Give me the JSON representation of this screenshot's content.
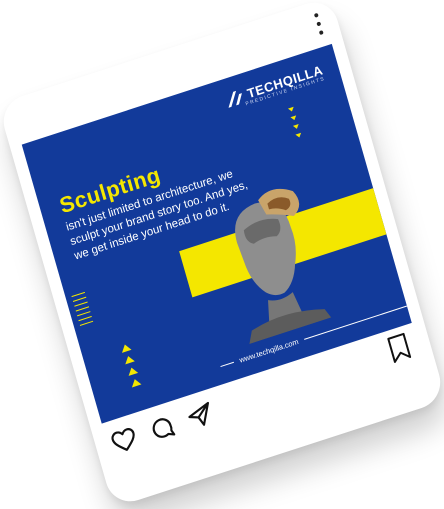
{
  "post": {
    "brand": "TECHQILLA",
    "brand_tagline": "PREDICTIVE INSIGHTS",
    "headline": "Sculpting",
    "body": "isn't just limited to architecture, we sculpt your brand story too. And yes, we get inside your head to do it.",
    "url": "www.techqilla.com"
  },
  "colors": {
    "background": "#123a9a",
    "accent": "#f4e700",
    "card": "#ffffff"
  },
  "icons": {
    "like": "heart-icon",
    "comment": "comment-icon",
    "share": "send-icon",
    "save": "bookmark-icon",
    "more": "more-vertical-icon"
  }
}
